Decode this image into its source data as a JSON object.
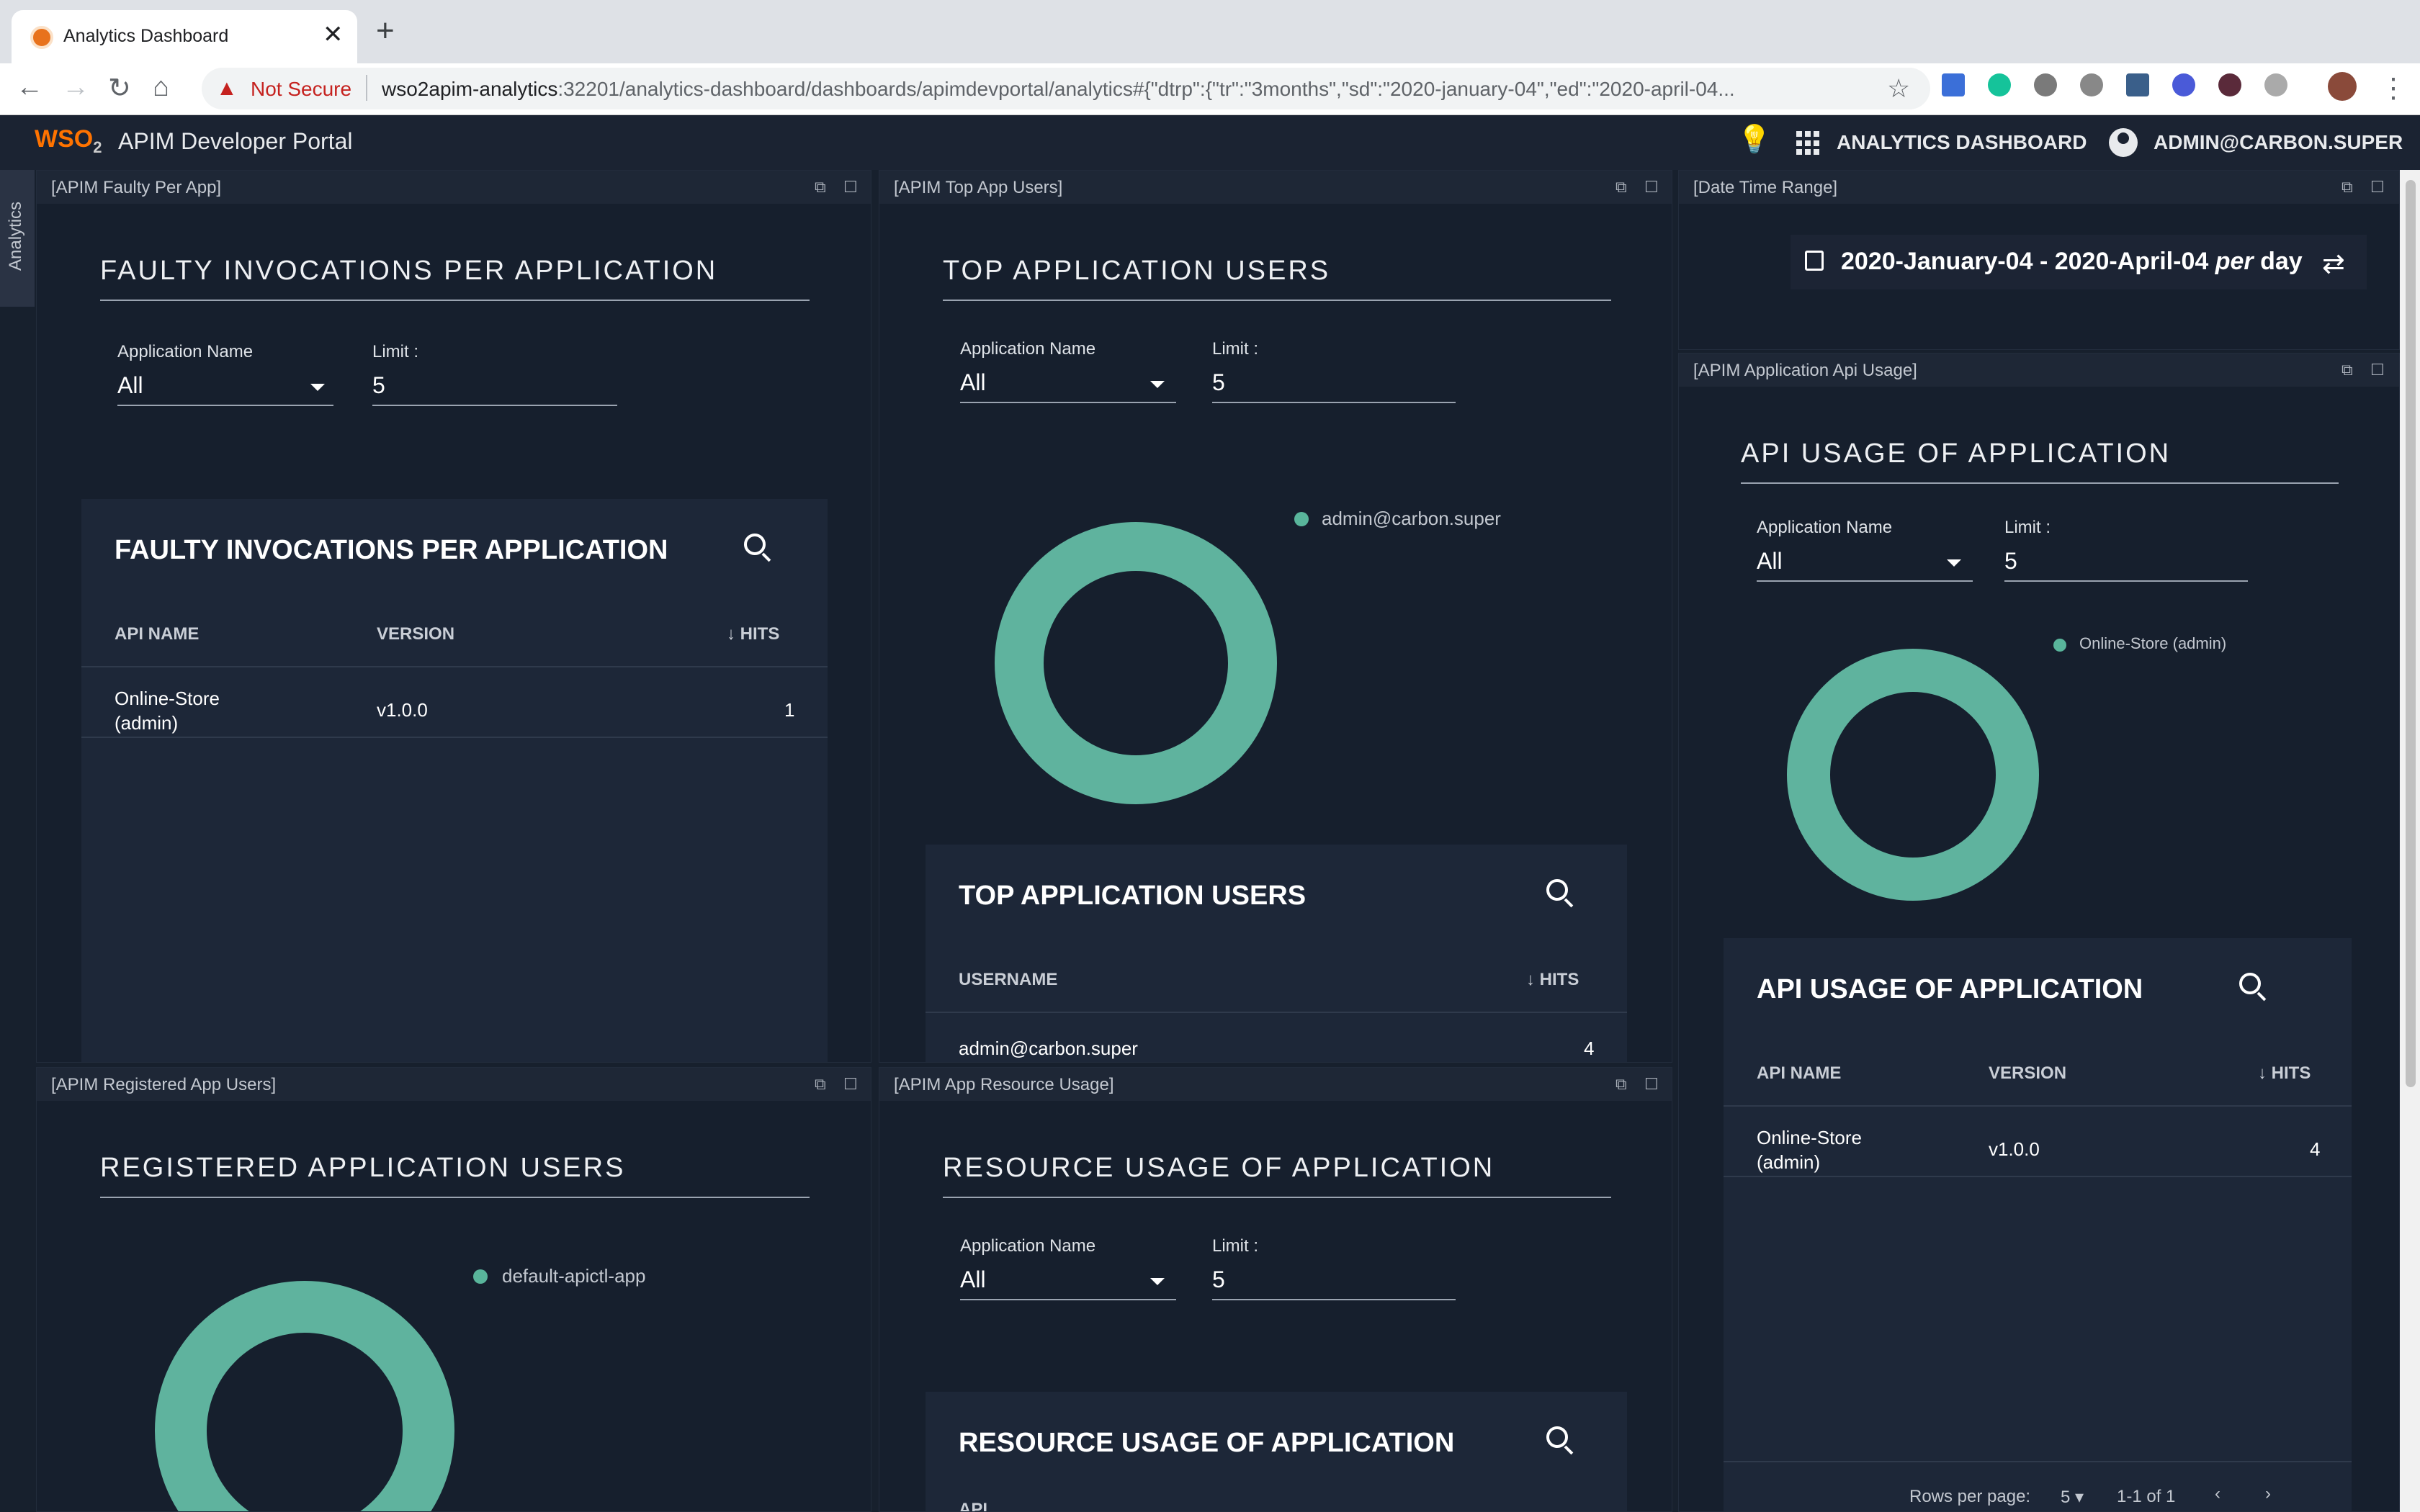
{
  "browser": {
    "tab_title": "Analytics Dashboard",
    "tab_close": "✕",
    "new_tab": "+",
    "not_secure": "Not Secure",
    "url_host": "wso2apim-analytics",
    "url_rest": ":32201/analytics-dashboard/dashboards/apimdevportal/analytics#{\"dtrp\":{\"tr\":\"3months\",\"sd\":\"2020-january-04\",\"ed\":\"2020-april-04..."
  },
  "header": {
    "logo_text": "WSO",
    "logo_sub": "2",
    "title": "APIM Developer Portal",
    "dashboard_link": "ANALYTICS DASHBOARD",
    "user": "ADMIN@CARBON.SUPER"
  },
  "sidebar": {
    "label": "Analytics"
  },
  "widgets": {
    "faulty": {
      "header": "[APIM Faulty Per App]",
      "title": "FAULTY INVOCATIONS PER APPLICATION",
      "app_name_label": "Application Name",
      "app_name_value": "All",
      "limit_label": "Limit :",
      "limit_value": "5",
      "card_title": "FAULTY INVOCATIONS PER APPLICATION",
      "columns": [
        "API NAME",
        "VERSION",
        "HITS"
      ],
      "rows": [
        {
          "api_name_line1": "Online-Store",
          "api_name_line2": "(admin)",
          "version": "v1.0.0",
          "hits": "1"
        }
      ]
    },
    "top_users": {
      "header": "[APIM Top App Users]",
      "title": "TOP APPLICATION USERS",
      "app_name_label": "Application Name",
      "app_name_value": "All",
      "limit_label": "Limit :",
      "limit_value": "5",
      "legend": "admin@carbon.super",
      "card_title": "TOP APPLICATION USERS",
      "columns": [
        "USERNAME",
        "HITS"
      ],
      "rows": [
        {
          "username": "admin@carbon.super",
          "hits": "4"
        }
      ]
    },
    "date_range": {
      "header": "[Date Time Range]",
      "range": "2020-January-04 - 2020-April-04",
      "per": "per",
      "granularity": "day"
    },
    "api_usage": {
      "header": "[APIM Application Api Usage]",
      "title": "API USAGE OF APPLICATION",
      "app_name_label": "Application Name",
      "app_name_value": "All",
      "limit_label": "Limit :",
      "limit_value": "5",
      "legend": "Online-Store (admin)",
      "card_title": "API USAGE OF APPLICATION",
      "columns": [
        "API NAME",
        "VERSION",
        "HITS"
      ],
      "rows": [
        {
          "api_name_line1": "Online-Store",
          "api_name_line2": "(admin)",
          "version": "v1.0.0",
          "hits": "4"
        }
      ],
      "rows_per_page_label": "Rows per page:",
      "rows_per_page_value": "5",
      "page_range": "1-1 of 1"
    },
    "registered": {
      "header": "[APIM Registered App Users]",
      "title": "REGISTERED APPLICATION USERS",
      "legend": "default-apictl-app"
    },
    "resource": {
      "header": "[APIM App Resource Usage]",
      "title": "RESOURCE USAGE OF APPLICATION",
      "app_name_label": "Application Name",
      "app_name_value": "All",
      "limit_label": "Limit :",
      "limit_value": "5",
      "card_title": "RESOURCE USAGE OF APPLICATION",
      "first_column": "API"
    }
  },
  "colors": {
    "donut": "#5fb39e",
    "background": "#161f2d",
    "accent": "#ff7300"
  }
}
